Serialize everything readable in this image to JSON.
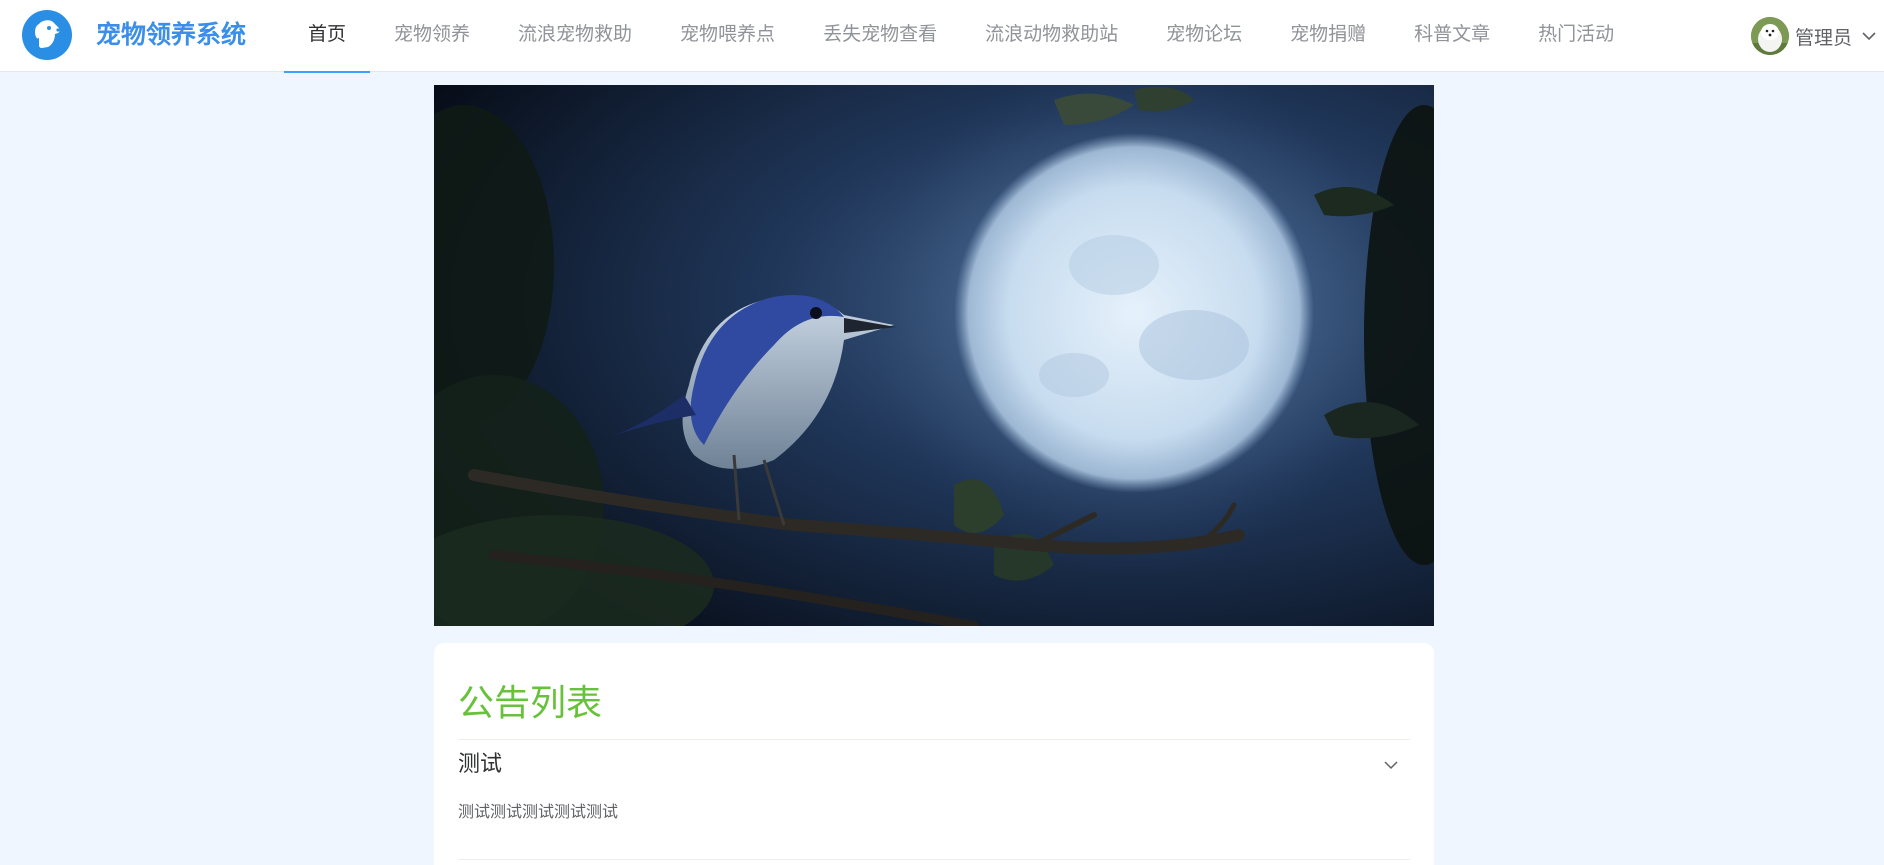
{
  "header": {
    "brand": "宠物领养系统",
    "nav": [
      {
        "label": "首页",
        "active": true
      },
      {
        "label": "宠物领养",
        "active": false
      },
      {
        "label": "流浪宠物救助",
        "active": false
      },
      {
        "label": "宠物喂养点",
        "active": false
      },
      {
        "label": "丢失宠物查看",
        "active": false
      },
      {
        "label": "流浪动物救助站",
        "active": false
      },
      {
        "label": "宠物论坛",
        "active": false
      },
      {
        "label": "宠物捐赠",
        "active": false
      },
      {
        "label": "科普文章",
        "active": false
      },
      {
        "label": "热门活动",
        "active": false
      }
    ],
    "user": {
      "name": "管理员"
    }
  },
  "notices": {
    "title": "公告列表",
    "items": [
      {
        "title": "测试",
        "content": "测试测试测试测试测试",
        "expanded": true
      }
    ]
  },
  "colors": {
    "brand": "#3b8eea",
    "accent": "#409eff",
    "notice_title": "#67c23a",
    "page_bg": "#eff6ff"
  },
  "icons": {
    "logo": "dog-head-icon",
    "user_menu": "chevron-down-icon",
    "notice_toggle": "chevron-down-icon"
  }
}
